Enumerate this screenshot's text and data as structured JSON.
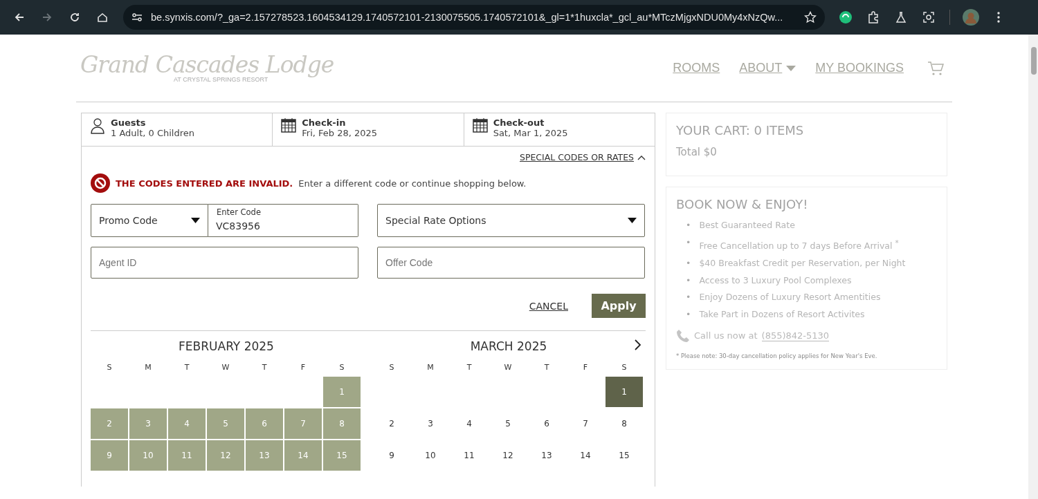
{
  "browser": {
    "url": "be.synxis.com/?_ga=2.157278523.1604534129.1740572101-2130075505.1740572101&_gl=1*1huxcla*_gcl_au*MTczMjgxNDU0My4xNzQw...",
    "forward_disabled": true
  },
  "header": {
    "logo_title": "Grand Cascades Lodge",
    "logo_subtitle": "AT CRYSTAL SPRINGS RESORT",
    "nav": [
      {
        "label": "ROOMS",
        "dropdown": false
      },
      {
        "label": "ABOUT",
        "dropdown": true
      },
      {
        "label": "MY BOOKINGS",
        "dropdown": false
      }
    ]
  },
  "booking_bar": [
    {
      "kind": "guests",
      "label": "Guests",
      "value": "1 Adult, 0 Children"
    },
    {
      "kind": "date",
      "label": "Check-in",
      "value": "Fri, Feb 28, 2025"
    },
    {
      "kind": "date",
      "label": "Check-out",
      "value": "Sat, Mar 1, 2025"
    }
  ],
  "codes": {
    "toggle_label": "SPECIAL CODES OR RATES",
    "expanded": true,
    "error": {
      "title": "THE CODES ENTERED ARE INVALID.",
      "message": "Enter a different code or continue shopping below."
    },
    "promo_select": "Promo Code",
    "code_label": "Enter Code",
    "code_value": "VC83956",
    "special_rate": "Special Rate Options",
    "agent_placeholder": "Agent ID",
    "offer_placeholder": "Offer Code",
    "cancel": "CANCEL",
    "apply": "Apply"
  },
  "calendar": {
    "months": [
      {
        "title": "FEBRUARY 2025",
        "weekdays": [
          "S",
          "M",
          "T",
          "W",
          "T",
          "F",
          "S"
        ],
        "weeks": [
          [
            {
              "kind": "blank"
            },
            {
              "kind": "blank"
            },
            {
              "kind": "blank"
            },
            {
              "kind": "blank"
            },
            {
              "kind": "blank"
            },
            {
              "kind": "blank"
            },
            {
              "kind": "shaded",
              "day": "1"
            }
          ],
          [
            {
              "kind": "shaded",
              "day": "2"
            },
            {
              "kind": "shaded",
              "day": "3"
            },
            {
              "kind": "shaded",
              "day": "4"
            },
            {
              "kind": "shaded",
              "day": "5"
            },
            {
              "kind": "shaded",
              "day": "6"
            },
            {
              "kind": "shaded",
              "day": "7"
            },
            {
              "kind": "shaded",
              "day": "8"
            }
          ],
          [
            {
              "kind": "shaded",
              "day": "9"
            },
            {
              "kind": "shaded",
              "day": "10"
            },
            {
              "kind": "shaded",
              "day": "11"
            },
            {
              "kind": "shaded",
              "day": "12"
            },
            {
              "kind": "shaded",
              "day": "13"
            },
            {
              "kind": "shaded",
              "day": "14"
            },
            {
              "kind": "shaded",
              "day": "15"
            }
          ]
        ]
      },
      {
        "title": "MARCH 2025",
        "weekdays": [
          "S",
          "M",
          "T",
          "W",
          "T",
          "F",
          "S"
        ],
        "weeks": [
          [
            {
              "kind": "blank"
            },
            {
              "kind": "blank"
            },
            {
              "kind": "blank"
            },
            {
              "kind": "blank"
            },
            {
              "kind": "blank"
            },
            {
              "kind": "blank"
            },
            {
              "kind": "selected",
              "day": "1"
            }
          ],
          [
            {
              "kind": "plain",
              "day": "2"
            },
            {
              "kind": "plain",
              "day": "3"
            },
            {
              "kind": "plain",
              "day": "4"
            },
            {
              "kind": "plain",
              "day": "5"
            },
            {
              "kind": "plain",
              "day": "6"
            },
            {
              "kind": "plain",
              "day": "7"
            },
            {
              "kind": "plain",
              "day": "8"
            }
          ],
          [
            {
              "kind": "plain",
              "day": "9"
            },
            {
              "kind": "plain",
              "day": "10"
            },
            {
              "kind": "plain",
              "day": "11"
            },
            {
              "kind": "plain",
              "day": "12"
            },
            {
              "kind": "plain",
              "day": "13"
            },
            {
              "kind": "plain",
              "day": "14"
            },
            {
              "kind": "plain",
              "day": "15"
            }
          ]
        ]
      }
    ]
  },
  "cart": {
    "title": "YOUR CART: 0 ITEMS",
    "total": "Total $0"
  },
  "promo": {
    "title": "BOOK NOW & ENJOY!",
    "items": [
      {
        "bullet": "•",
        "text": "Best Guaranteed Rate"
      },
      {
        "bullet": "•",
        "text": "Free Cancellation up to 7 days Before Arrival $^{*}$"
      },
      {
        "bullet": "•",
        "text": "$40 Breakfast Credit per Reservation, per Night"
      },
      {
        "bullet": "•",
        "text": "Access to 3 Luxury Pool Complexes"
      },
      {
        "bullet": "•",
        "text": "Enjoy Dozens of Luxury Resort Amentities"
      },
      {
        "bullet": "•",
        "text": "Take Part in Dozens of Resort Activites"
      }
    ],
    "call_label": "Call us now at",
    "phone": "(855)842-5130",
    "note": "* Please note: 30-day cancellation policy applies for New Year's Eve."
  }
}
